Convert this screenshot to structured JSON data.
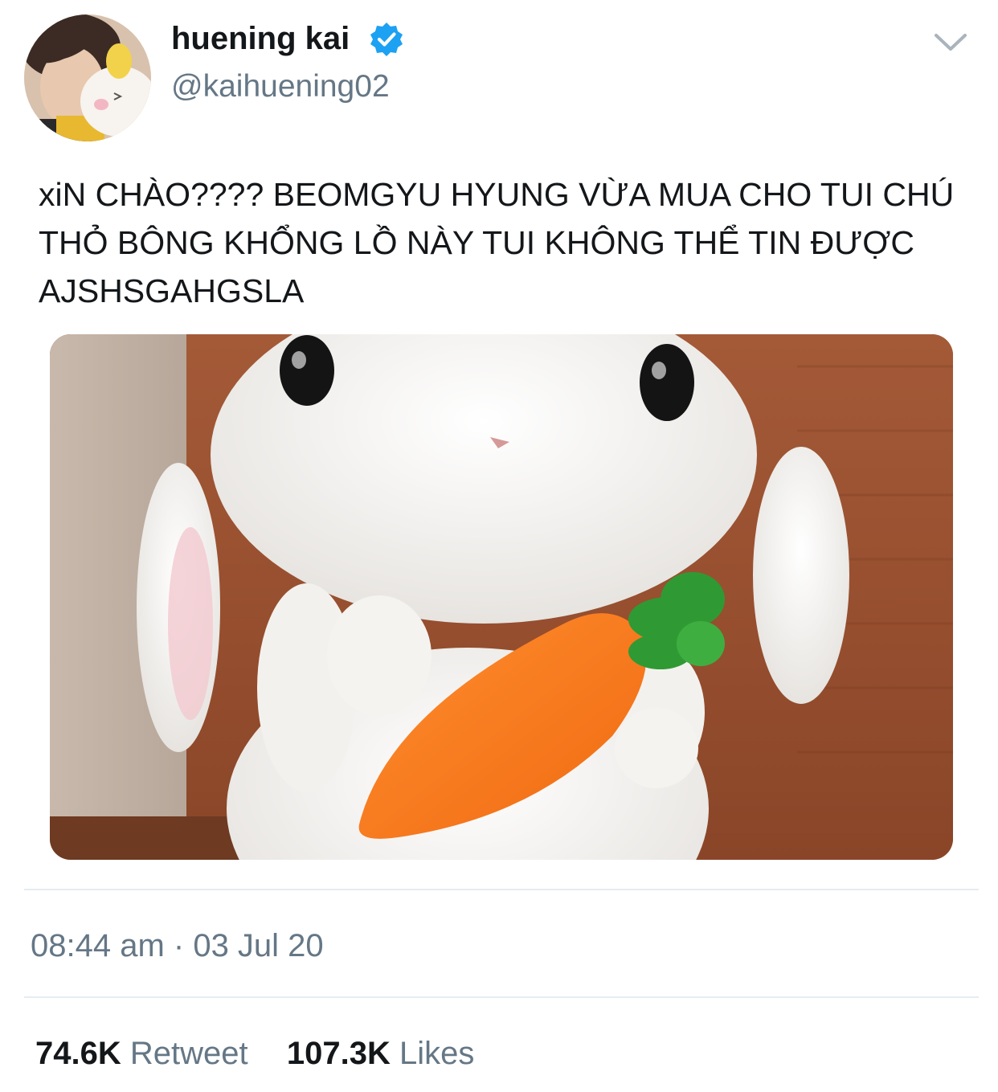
{
  "tweet": {
    "author": {
      "display_name": "huening kai",
      "handle": "@kaihuening02",
      "verified_icon": "verified-badge-icon",
      "avatar_icon": "profile-avatar"
    },
    "menu_icon": "chevron-down-icon",
    "text": "xiN CHÀO???? BEOMGYU HYUNG VỪA MUA CHO TUI CHÚ THỎ BÔNG KHỔNG LỒ NÀY TUI KHÔNG THỂ TIN ĐƯỢC AJSHSGAHGSLA",
    "media_alt_icon": "photo-plush-bunny-with-carrot",
    "timestamp": "08:44 am · 03 Jul 20",
    "stats": {
      "retweets_count": "74.6K",
      "retweets_label": "Retweet",
      "likes_count": "107.3K",
      "likes_label": "Likes"
    }
  },
  "colors": {
    "text_primary": "#14171a",
    "text_secondary": "#657786",
    "verified_blue": "#1da1f2",
    "divider": "#e6ecf0"
  }
}
